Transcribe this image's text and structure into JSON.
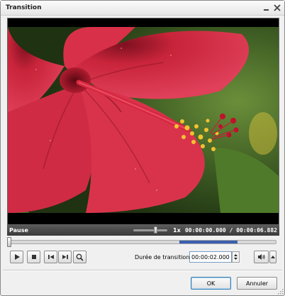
{
  "window": {
    "title": "Transition",
    "minimize_icon": "minimize-icon",
    "close_icon": "close-icon"
  },
  "player": {
    "status": "Pause",
    "speed_label": "1x",
    "time_display": "00:00:00.000 / 00:00:06.882",
    "video_content": "red-hibiscus-flower"
  },
  "controls": {
    "icons": [
      "play-icon",
      "stop-icon",
      "previous-frame-icon",
      "next-frame-icon",
      "zoom-icon",
      "volume-icon",
      "chevron-up-icon"
    ],
    "duration_label": "Durée de transition:",
    "duration_value": "00:00:02.000"
  },
  "buttons": {
    "ok_label": "OK",
    "cancel_label": "Annuler"
  },
  "colors": {
    "seek_range": "#3a5fae",
    "status_bar": "#474747"
  }
}
